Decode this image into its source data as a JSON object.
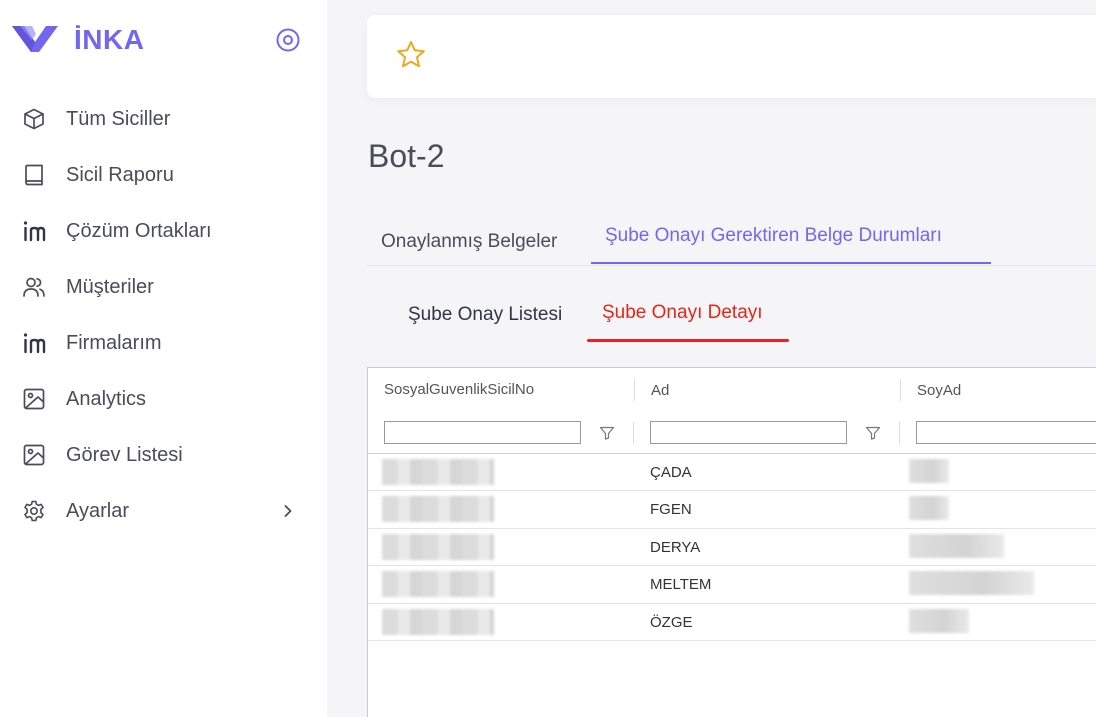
{
  "brand": {
    "name": "İNKA"
  },
  "sidebar": {
    "items": [
      {
        "label": "Tüm Siciller",
        "icon": "cube-icon"
      },
      {
        "label": "Sicil Raporu",
        "icon": "book-icon"
      },
      {
        "label": "Çözüm Ortakları",
        "icon": "linkedin-icon"
      },
      {
        "label": "Müşteriler",
        "icon": "users-icon"
      },
      {
        "label": "Firmalarım",
        "icon": "linkedin-icon"
      },
      {
        "label": "Analytics",
        "icon": "image-icon"
      },
      {
        "label": "Görev Listesi",
        "icon": "image-icon"
      },
      {
        "label": "Ayarlar",
        "icon": "gear-icon"
      }
    ]
  },
  "page": {
    "title": "Bot-2"
  },
  "tabs": {
    "tab1": "Onaylanmış Belgeler",
    "tab2": "Şube Onayı Gerektiren Belge Durumları"
  },
  "subtabs": {
    "sub1": "Şube Onay Listesi",
    "sub2": "Şube Onayı Detayı"
  },
  "grid": {
    "columns": [
      "SosyalGuvenlikSicilNo",
      "Ad",
      "SoyAd"
    ],
    "filters": [
      "",
      "",
      ""
    ],
    "rows": [
      {
        "sicil": "",
        "ad": "ÇADA",
        "soyad": ""
      },
      {
        "sicil": "",
        "ad": "FGEN",
        "soyad": ""
      },
      {
        "sicil": "",
        "ad": "DERYA",
        "soyad": ""
      },
      {
        "sicil": "",
        "ad": "MELTEM",
        "soyad": ""
      },
      {
        "sicil": "",
        "ad": "ÖZGE",
        "soyad": ""
      }
    ]
  },
  "colors": {
    "accent": "#7367f0",
    "active_subtab": "#e3261b"
  }
}
